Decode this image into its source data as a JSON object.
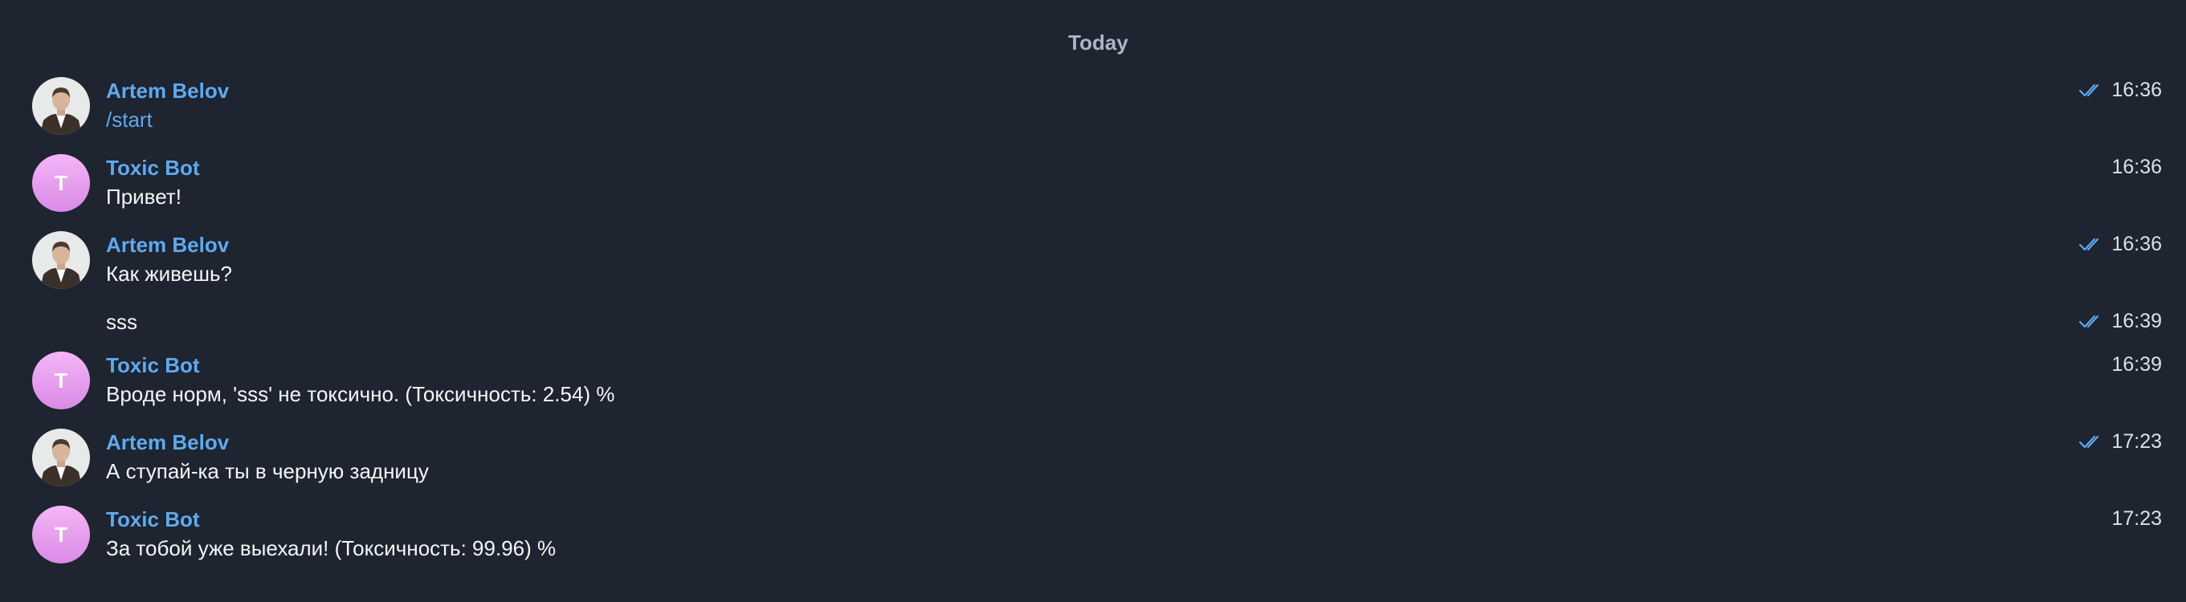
{
  "chat": {
    "date_separator": "Today",
    "messages": [
      {
        "sender": "Artem Belov",
        "text": "/start",
        "time": "16:36",
        "avatar": "photo",
        "read": true
      },
      {
        "sender": "Toxic Bot",
        "text": "Привет!",
        "time": "16:36",
        "avatar": "T",
        "read": false
      },
      {
        "sender": "Artem Belov",
        "text": "Как живешь?",
        "time": "16:36",
        "avatar": "photo",
        "read": true
      },
      {
        "sender": "",
        "text": "sss",
        "time": "16:39",
        "avatar": "",
        "read": true
      },
      {
        "sender": "Toxic Bot",
        "text": "Вроде норм, 'sss' не токсично. (Токсичность: 2.54) %",
        "time": "16:39",
        "avatar": "T",
        "read": false
      },
      {
        "sender": "Artem Belov",
        "text": "А ступай-ка ты в черную задницу",
        "time": "17:23",
        "avatar": "photo",
        "read": true
      },
      {
        "sender": "Toxic Bot",
        "text": "За тобой уже выехали! (Токсичность: 99.96) %",
        "time": "17:23",
        "avatar": "T",
        "read": false
      }
    ]
  },
  "colors": {
    "background": "#1e2430",
    "sender_name": "#5eaaf0",
    "bot_avatar": "#e9a2f0",
    "read_check": "#5eaaf0"
  },
  "icons": {
    "read_receipt": "double-check-icon",
    "user_avatar": "user-photo-avatar"
  }
}
